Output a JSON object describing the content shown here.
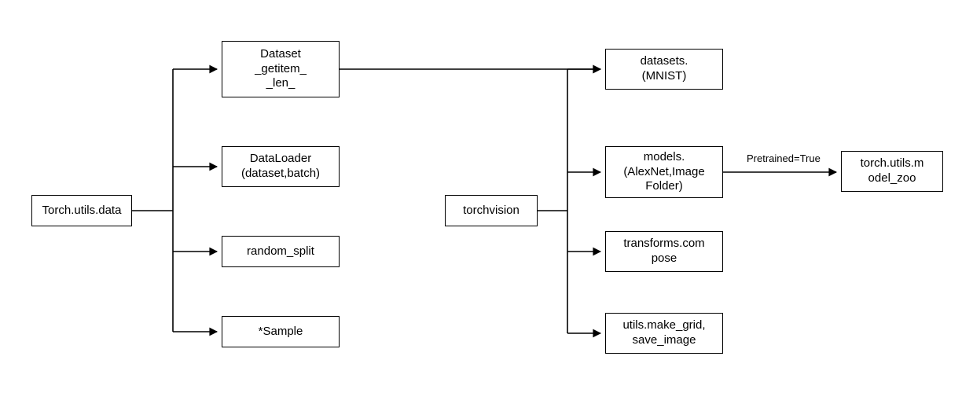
{
  "nodes": {
    "root_left": "Torch.utils.data",
    "dataset": "Dataset\n_getitem_\n_len_",
    "dataloader": "DataLoader\n(dataset,batch)",
    "random_split": "random_split",
    "sample": "*Sample",
    "torchvision": "torchvision",
    "datasets_mnist": "datasets.\n(MNIST)",
    "models": "models.\n(AlexNet,Image\nFolder)",
    "transforms": "transforms.com\npose",
    "utils_img": "utils.make_grid,\nsave_image",
    "model_zoo": "torch.utils.m\nodel_zoo"
  },
  "edge_labels": {
    "pretrained": "Pretrained=True"
  }
}
